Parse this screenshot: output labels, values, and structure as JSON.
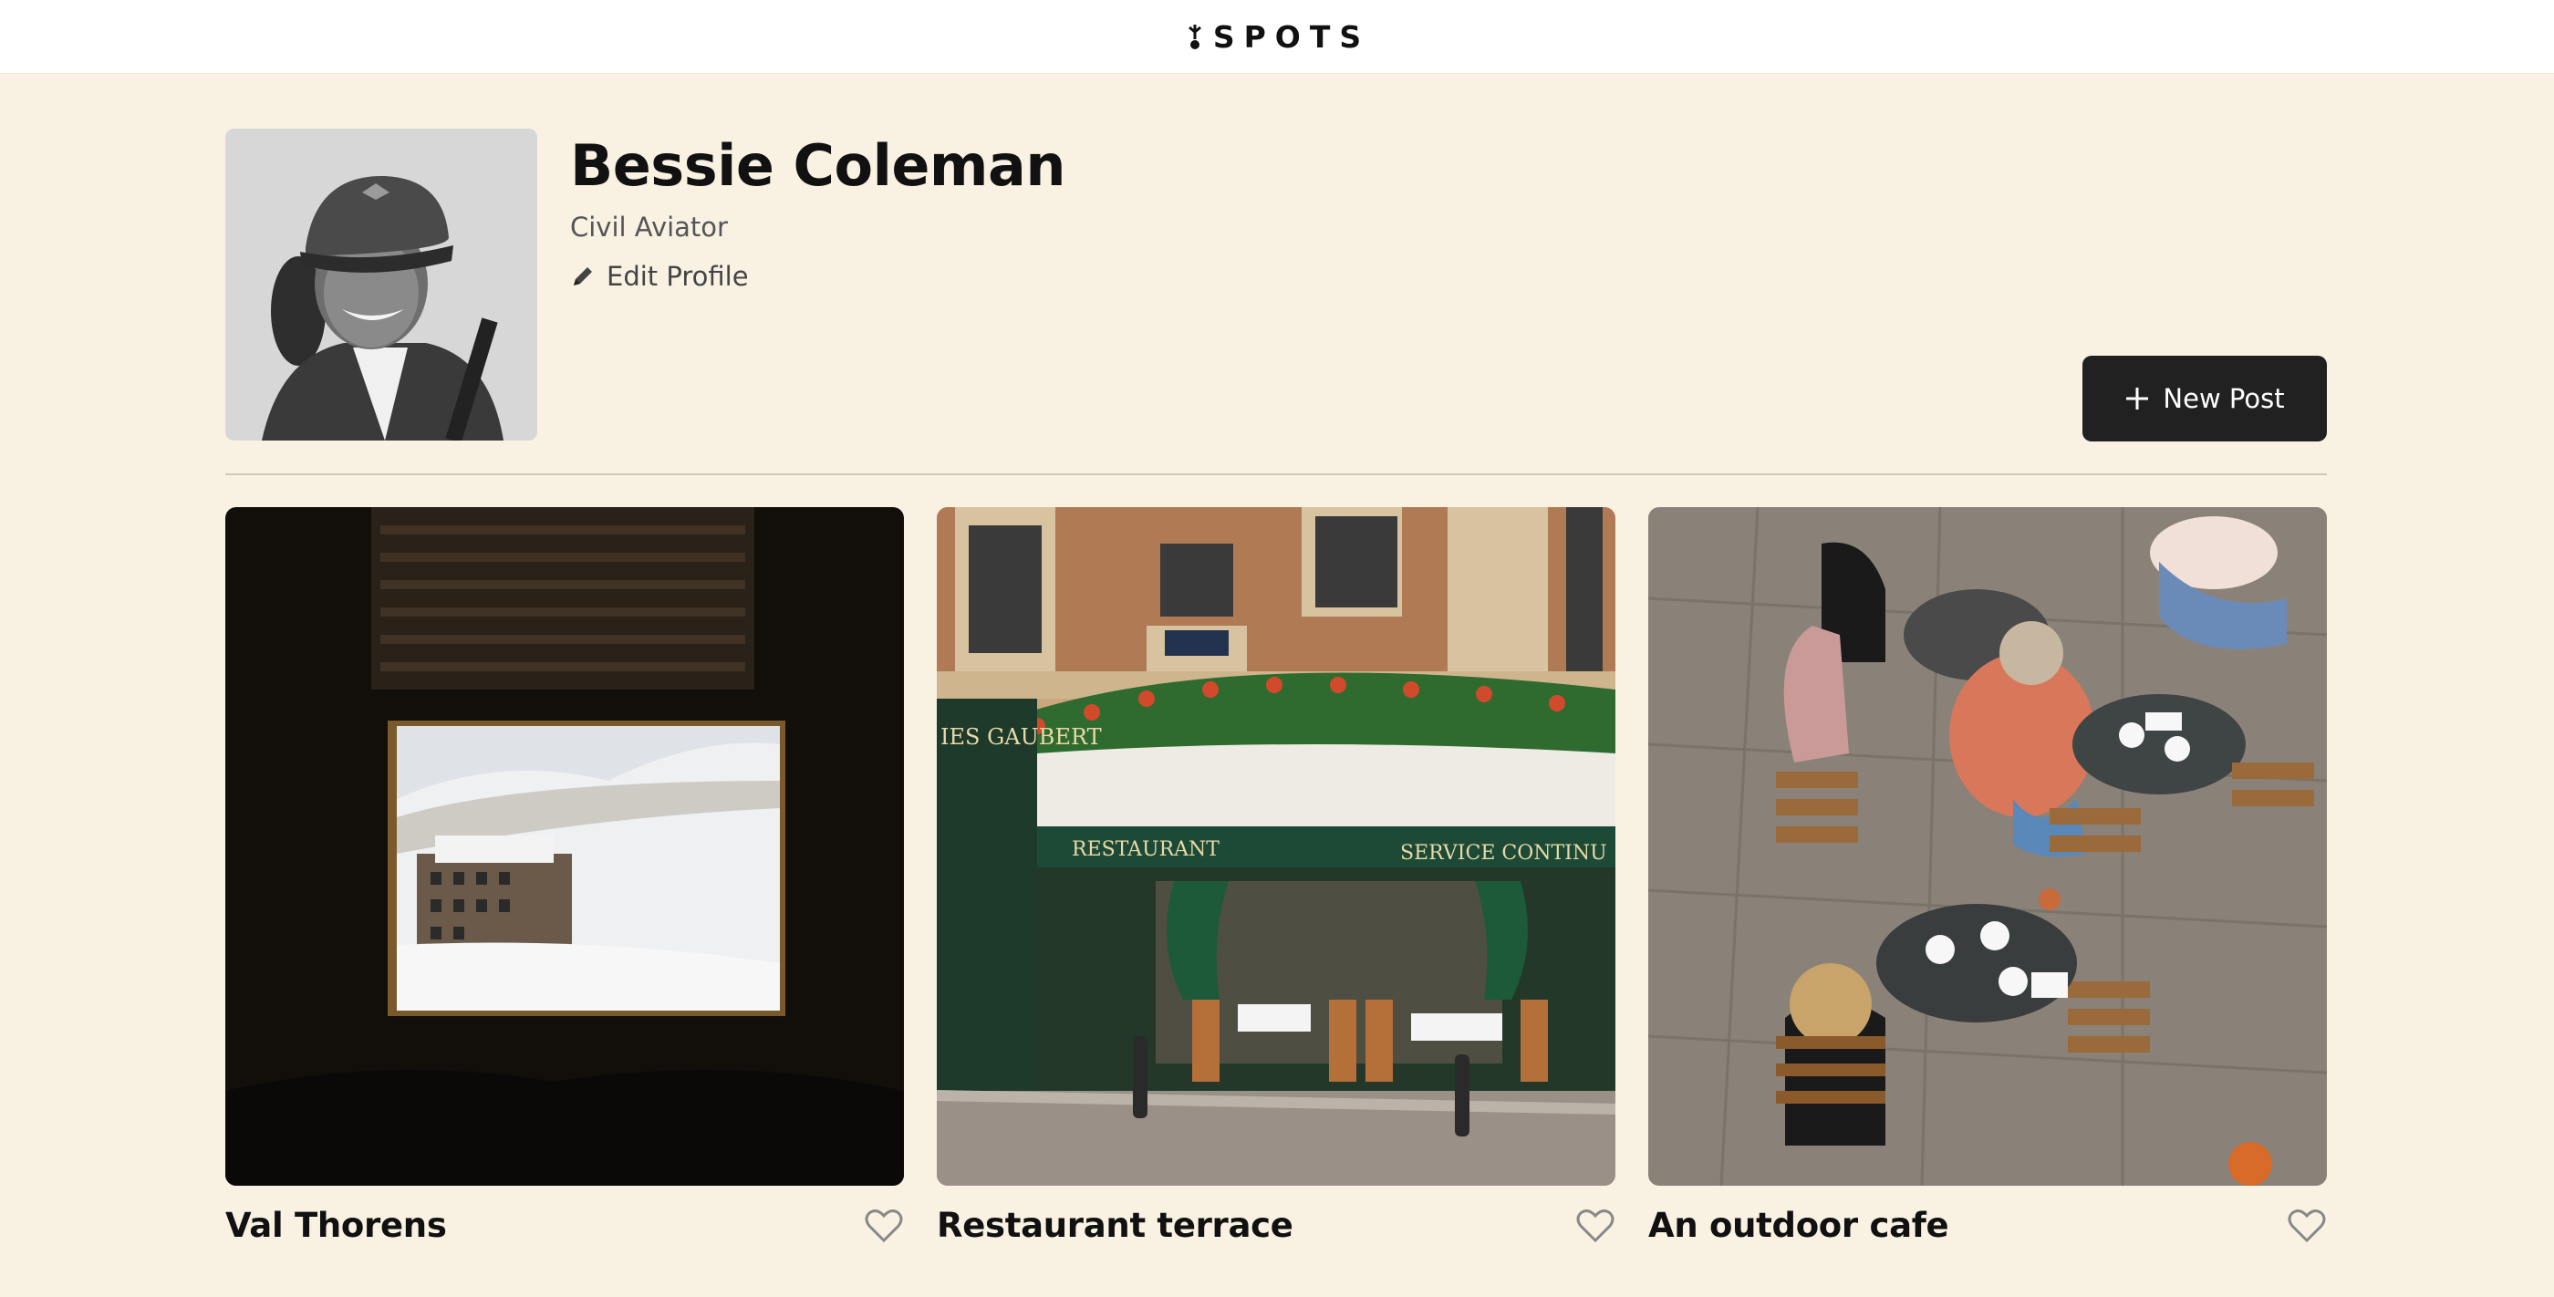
{
  "header": {
    "logo_text": "SPOTS",
    "logo_icon": "flower-icon"
  },
  "profile": {
    "name": "Bessie Coleman",
    "role": "Civil Aviator",
    "edit_label": "Edit Profile",
    "new_post_label": "New Post"
  },
  "cards": [
    {
      "title": "Val Thorens",
      "image": "snowy-village-through-window"
    },
    {
      "title": "Restaurant terrace",
      "image": "paris-restaurant-front",
      "sign_left": "IES GAUBERT",
      "awning_left": "RESTAURANT",
      "awning_right": "SERVICE CONTINU"
    },
    {
      "title": "An outdoor cafe",
      "image": "cafe-tables-from-above"
    }
  ],
  "colors": {
    "background": "#f9f2e3",
    "button": "#212121",
    "divider": "#cfc8b8"
  }
}
